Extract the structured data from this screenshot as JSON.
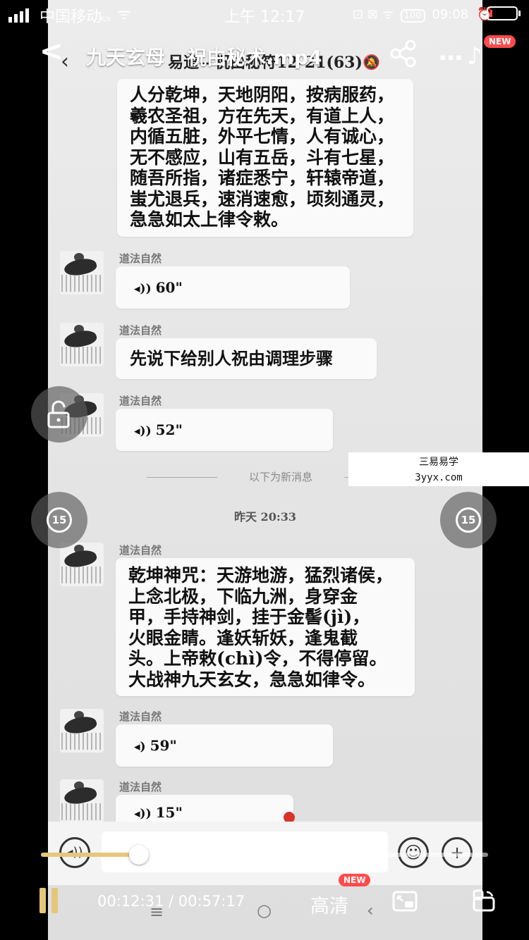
{
  "status_bar": {
    "carrier": "中国移动",
    "net_speed": "K/s",
    "clock": "上午 12:17",
    "right_group": "⊡ ⊠ ᯤ",
    "battery_level": "100",
    "inner_time": "09:08"
  },
  "player": {
    "title": "九天玄母 - 祝由秘术.mp4",
    "new_badge": "NEW",
    "current_time": "00:12:31",
    "separator": "/",
    "total_time": "00:57:17",
    "quality_label": "高清",
    "quality_badge": "NEW",
    "progress_fraction": 0.2185,
    "seek_back_seconds": "15",
    "seek_forward_seconds": "15"
  },
  "watermark": {
    "line1": "三易易学",
    "line2": "3yyx.com"
  },
  "video_content": {
    "chat_title": "易道—祝由秘符12-21(63)",
    "poem1": [
      "人分乾坤，天地阴阳，按病服药，",
      "羲农圣祖，方在先天，有道上人，",
      "内循五脏，外平七情，人有诚心，",
      "无不感应，山有五岳，斗有七星，",
      "随吾所指，诸症悉宁，轩辕帝道，",
      "蚩尤退兵，速消速愈，顷刻通灵，",
      "急急如太上律令敕。"
    ],
    "sender": "道法自然",
    "voice1": "60\"",
    "text1": "先说下给别人祝由调理步骤",
    "voice2": "52\"",
    "new_msg_divider": "以下为新消息",
    "timestamp": "昨天 20:33",
    "poem2": [
      "乾坤神咒：天游地游，猛烈诸侯，",
      "上念北极，下临九洲，身穿金",
      "甲，手持神剑，挂于金髻(jì)，",
      "火眼金睛。逢妖斩妖，逢鬼截",
      "头。上帝敕(chì)令，不得停留。",
      "大战神九天玄女，急急如律令。"
    ],
    "voice3": "59\"",
    "voice4": "15\""
  },
  "colors": {
    "progress_played": "#e6c77a",
    "badge": "#ff4b4b"
  }
}
